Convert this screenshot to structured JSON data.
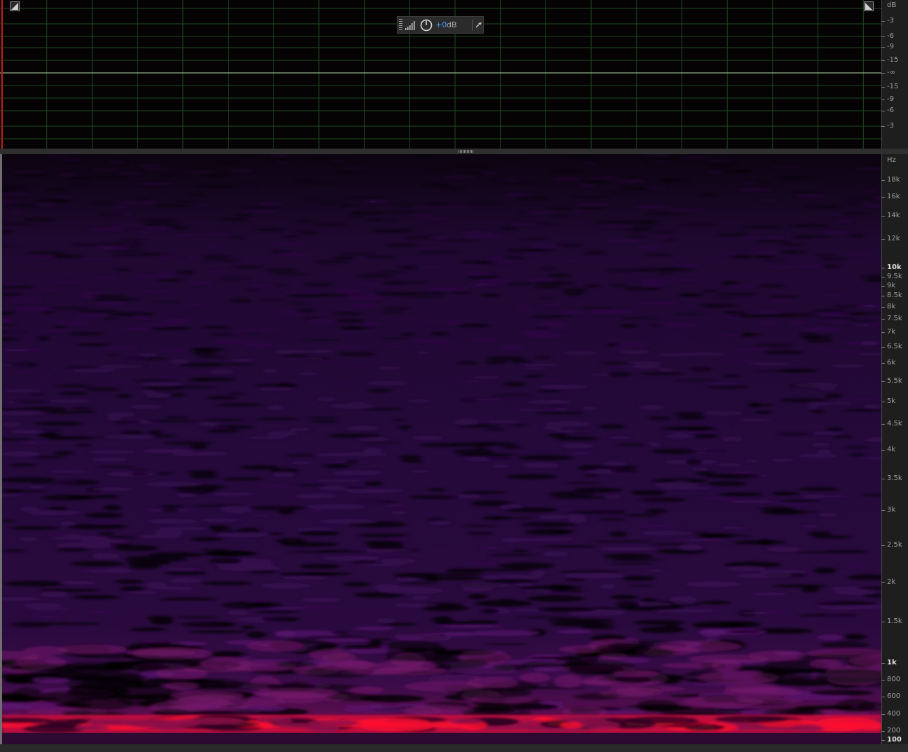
{
  "waveform": {
    "hud": {
      "gain_value": "+0",
      "gain_unit": "dB"
    },
    "db_ruler": {
      "unit": "dB",
      "labels": [
        "-3",
        "-6",
        "-9",
        "-15",
        "-∞",
        "-15",
        "-9",
        "-6",
        "-3"
      ]
    }
  },
  "spectrogram": {
    "hz_ruler": {
      "unit": "Hz",
      "labels": [
        "18k",
        "16k",
        "14k",
        "12k",
        "10k",
        "9.5k",
        "9k",
        "8.5k",
        "8k",
        "7.5k",
        "7k",
        "6.5k",
        "6k",
        "5.5k",
        "5k",
        "4.5k",
        "4k",
        "3.5k",
        "3k",
        "2.5k",
        "2k",
        "1.5k",
        "1k",
        "800",
        "600",
        "400",
        "200",
        "100"
      ],
      "bold_labels": [
        "10k",
        "1k",
        "100"
      ]
    },
    "colors": {
      "low": "#0a030c",
      "mid": "#3a0a4a",
      "high": "#c01040",
      "peak": "#ff1030"
    }
  }
}
